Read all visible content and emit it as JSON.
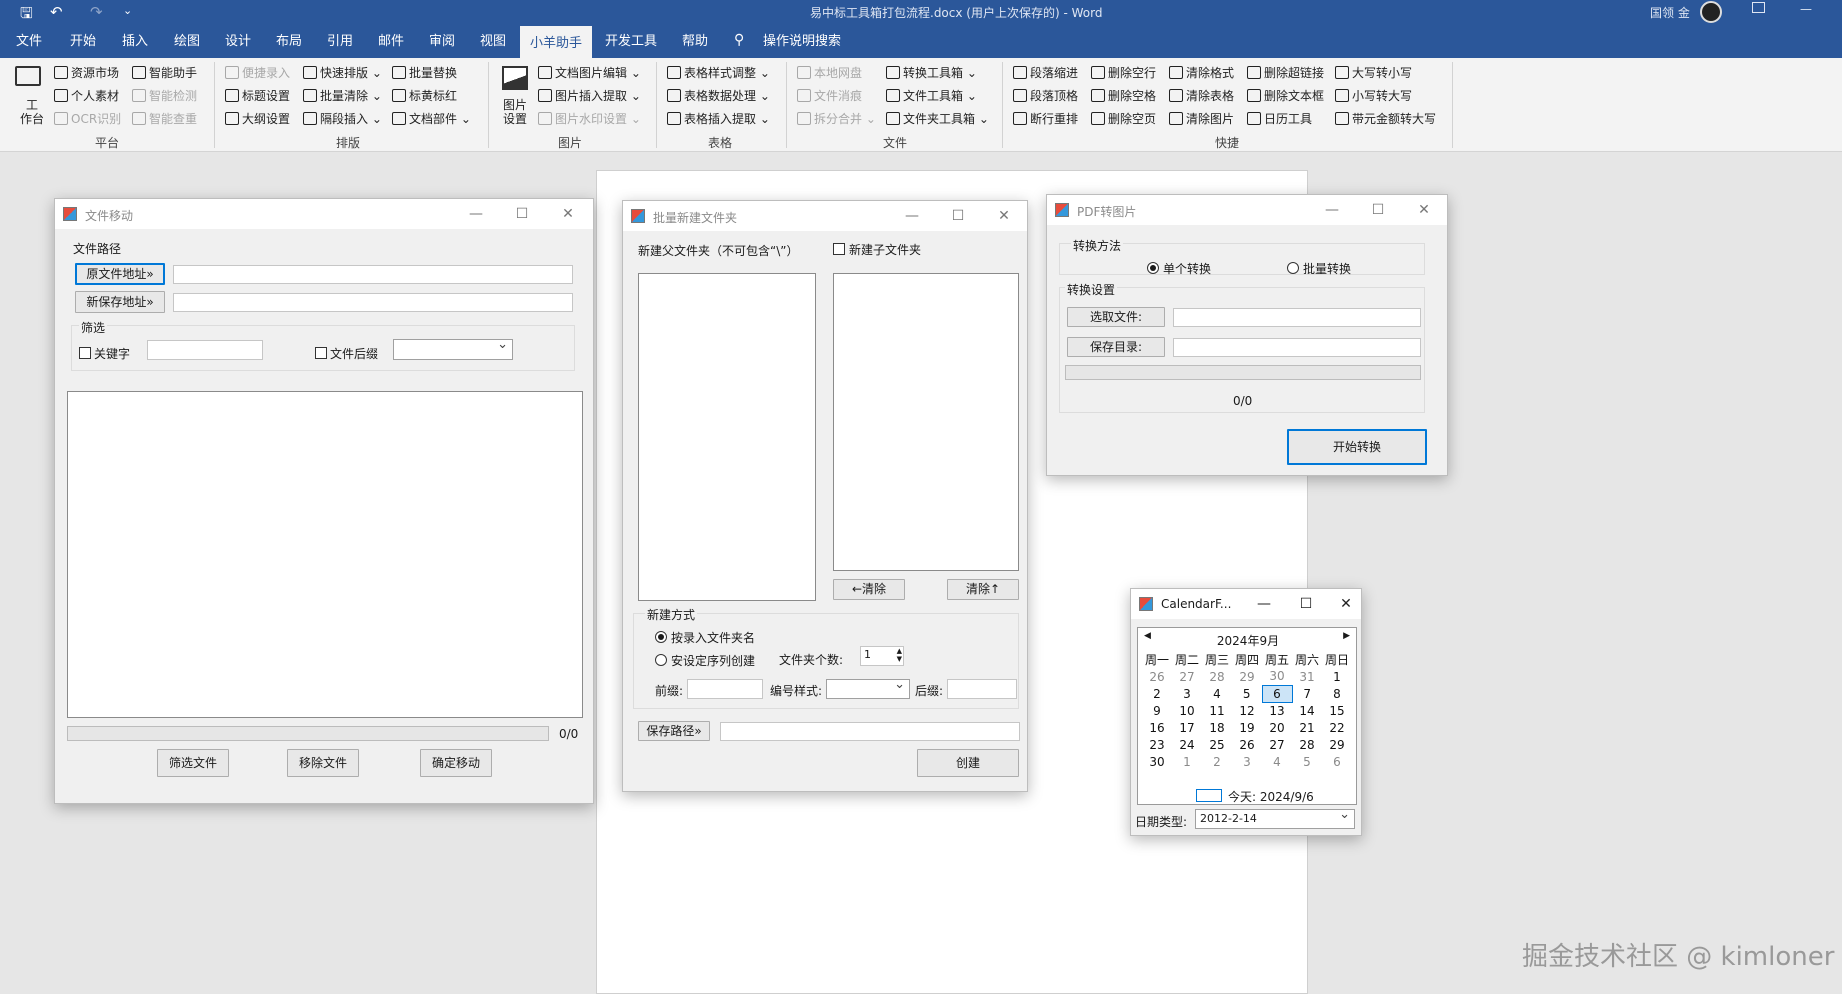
{
  "app": {
    "doc_title": "易中标工具箱打包流程.docx (用户上次保存的)  -  Word",
    "user": "国领 金",
    "minimize": "—"
  },
  "tabs": [
    "文件",
    "开始",
    "插入",
    "绘图",
    "设计",
    "布局",
    "引用",
    "邮件",
    "审阅",
    "视图",
    "小羊助手",
    "开发工具",
    "帮助",
    "操作说明搜索"
  ],
  "ribbon": {
    "workbench": "工\n作台",
    "g1": [
      "资源市场",
      "智能助手",
      "个人素材",
      "智能检测",
      "OCR识别",
      "智能查重"
    ],
    "g2": [
      "便捷录入",
      "快速排版",
      "批量替换",
      "标题设置",
      "批量清除",
      "标黄标红",
      "大纲设置",
      "隔段插入",
      "文档部件"
    ],
    "pic_settings": "图片\n设置",
    "g3": [
      "文档图片编辑",
      "图片插入提取",
      "图片水印设置"
    ],
    "g4": [
      "表格样式调整",
      "表格数据处理",
      "表格插入提取"
    ],
    "g5": [
      "本地网盘",
      "转换工具箱",
      "文件消痕",
      "文件工具箱",
      "拆分合并",
      "文件夹工具箱"
    ],
    "g6": [
      "段落缩进",
      "删除空行",
      "清除格式",
      "删除超链接",
      "大写转小写",
      "段落顶格",
      "删除空格",
      "清除表格",
      "删除文本框",
      "小写转大写",
      "断行重排",
      "删除空页",
      "清除图片",
      "日历工具",
      "带元金额转大写"
    ],
    "groups": [
      "平台",
      "排版",
      "图片",
      "表格",
      "文件",
      "快捷"
    ]
  },
  "win_move": {
    "title": "文件移动",
    "path_group": "文件路径",
    "src_btn": "原文件地址»",
    "dst_btn": "新保存地址»",
    "filter_group": "筛选",
    "keyword": "关键字",
    "suffix": "文件后缀",
    "count": "0/0",
    "btn_filter": "筛选文件",
    "btn_remove": "移除文件",
    "btn_confirm": "确定移动"
  },
  "win_batch": {
    "title": "批量新建文件夹",
    "parent_label": "新建父文件夹（不可包含“\\”）",
    "sub_check": "新建子文件夹",
    "clear_left": "←清除",
    "clear_right": "清除↑",
    "method_group": "新建方式",
    "opt_name": "按录入文件夹名",
    "opt_seq": "安设定序列创建",
    "folder_count_label": "文件夹个数:",
    "folder_count": "1",
    "prefix": "前缀:",
    "num_style": "编号样式:",
    "suffix": "后缀:",
    "save_path_btn": "保存路径»",
    "create_btn": "创建"
  },
  "win_pdf": {
    "title": "PDF转图片",
    "method_group": "转换方法",
    "opt_single": "单个转换",
    "opt_batch": "批量转换",
    "settings_group": "转换设置",
    "select_file": "选取文件:",
    "save_dir": "保存目录:",
    "progress": "0/0",
    "start_btn": "开始转换"
  },
  "win_cal": {
    "title": "CalendarF...",
    "month": "2024年9月",
    "weekdays": [
      "周一",
      "周二",
      "周三",
      "周四",
      "周五",
      "周六",
      "周日"
    ],
    "weeks": [
      [
        "26",
        "27",
        "28",
        "29",
        "30",
        "31",
        "1"
      ],
      [
        "2",
        "3",
        "4",
        "5",
        "6",
        "7",
        "8"
      ],
      [
        "9",
        "10",
        "11",
        "12",
        "13",
        "14",
        "15"
      ],
      [
        "16",
        "17",
        "18",
        "19",
        "20",
        "21",
        "22"
      ],
      [
        "23",
        "24",
        "25",
        "26",
        "27",
        "28",
        "29"
      ],
      [
        "30",
        "1",
        "2",
        "3",
        "4",
        "5",
        "6"
      ]
    ],
    "today": "今天: 2024/9/6",
    "date_type_label": "日期类型:",
    "date_type_value": "2012-2-14"
  },
  "watermark": "掘金技术社区 @ kimloner"
}
